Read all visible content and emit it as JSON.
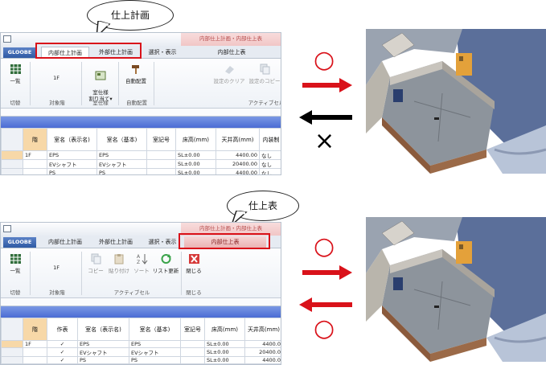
{
  "callouts": {
    "top": "仕上計画",
    "bottom": "仕上表"
  },
  "panel_top": {
    "context_header": "内部仕上計画・内部仕上表",
    "app_tab": "GLOOBE",
    "tabs": [
      "内部仕上計画",
      "外部仕上計画",
      "選択・表示",
      "内部仕上表"
    ],
    "ribbon": {
      "buttons": [
        "一覧",
        "1F",
        "室仕様\n割り当て▾",
        "自動配置",
        "設定のクリア",
        "設定のコピー"
      ],
      "groups": [
        "切替",
        "対象階",
        "室仕様",
        "自動配置",
        "アクティブセル"
      ]
    },
    "grid": {
      "headers": [
        "階",
        "室名（表示名)",
        "室名（基本)",
        "室記号",
        "床高(mm)",
        "天井高(mm)",
        "内装制"
      ],
      "rows": [
        [
          "1F",
          "EPS",
          "EPS",
          "",
          "SL±0.00",
          "4400.00",
          "なし"
        ],
        [
          "",
          "EVシャフト",
          "EVシャフト",
          "",
          "SL±0.00",
          "20400.00",
          "なし"
        ],
        [
          "",
          "PS",
          "PS",
          "",
          "SL±0.00",
          "4400.00",
          "なし"
        ]
      ]
    }
  },
  "panel_bottom": {
    "context_header": "内部仕上計画・内部仕上表",
    "app_tab": "GLOOBE",
    "tabs": [
      "内部仕上計画",
      "外部仕上計画",
      "選択・表示",
      "内部仕上表"
    ],
    "ribbon": {
      "buttons": [
        "一覧",
        "1F",
        "コピー",
        "貼り付け",
        "ソート",
        "リスト更新",
        "閉じる"
      ],
      "groups": [
        "切替",
        "対象階",
        "アクティブセル",
        "閉じる"
      ]
    },
    "grid": {
      "headers": [
        "階",
        "作表",
        "室名（表示名)",
        "室名（基本)",
        "室記号",
        "床高(mm)",
        "天井高(mm)"
      ],
      "rows": [
        [
          "1F",
          "✓",
          "EPS",
          "EPS",
          "",
          "SL±0.00",
          "4400.0"
        ],
        [
          "",
          "✓",
          "EVシャフト",
          "EVシャフト",
          "",
          "SL±0.00",
          "20400.0"
        ],
        [
          "",
          "✓",
          "PS",
          "PS",
          "",
          "SL±0.00",
          "4400.0"
        ]
      ]
    }
  },
  "symbols": {
    "ok": "○",
    "ng": "×"
  },
  "colors": {
    "accent_red": "#d9121a",
    "ribbon_blue": "#4b6cd4",
    "floor_highlight": "#f7d8a8"
  }
}
